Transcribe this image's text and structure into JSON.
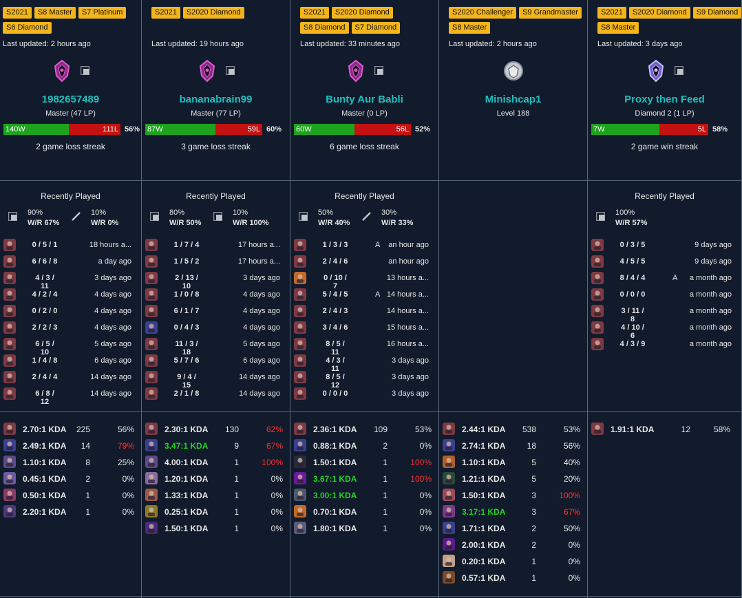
{
  "players": [
    {
      "tags": [
        "S2021",
        "S8 Master",
        "S7 Platinum",
        "S6 Diamond"
      ],
      "last_updated": "Last updated: 2 hours ago",
      "emblem": "master-emblem-icon",
      "name": "1982657489",
      "rank": "Master (47 LP)",
      "wins": "140W",
      "losses": "111L",
      "win_pct": "56%",
      "win_fraction": 0.56,
      "streak": "2 game loss streak",
      "recent_title": "Recently Played",
      "roles": [
        {
          "icon": "jungle-role-icon",
          "pct": "90%",
          "wr": "W/R 67%"
        },
        {
          "icon": "support-role-icon",
          "pct": "10%",
          "wr": "W/R 0%"
        }
      ],
      "recent": [
        {
          "kda": "0 / 5 / 1",
          "role": "",
          "ago": "18 hours a..."
        },
        {
          "kda": "6 / 6 / 8",
          "role": "",
          "ago": "a day ago"
        },
        {
          "kda": "4 / 3 / 11",
          "role": "",
          "ago": "3 days ago"
        },
        {
          "kda": "4 / 2 / 4",
          "role": "",
          "ago": "4 days ago"
        },
        {
          "kda": "0 / 2 / 0",
          "role": "",
          "ago": "4 days ago"
        },
        {
          "kda": "2 / 2 / 3",
          "role": "",
          "ago": "4 days ago"
        },
        {
          "kda": "6 / 5 / 10",
          "role": "",
          "ago": "5 days ago"
        },
        {
          "kda": "1 / 4 / 8",
          "role": "",
          "ago": "6 days ago"
        },
        {
          "kda": "2 / 4 / 4",
          "role": "",
          "ago": "14 days ago"
        },
        {
          "kda": "6 / 8 / 12",
          "role": "",
          "ago": "14 days ago"
        }
      ],
      "recent_champs": [
        "#7d3a44",
        "#7d3a44",
        "#7d3a44",
        "#7d3a44",
        "#7d3a44",
        "#7d3a44",
        "#7d3a44",
        "#7d3a44",
        "#7d3a44",
        "#7d3a44"
      ],
      "stats": [
        {
          "kda": "2.70:1 KDA",
          "games": "225",
          "wr": "56%",
          "kda_color": "",
          "wr_color": "",
          "champ": "#7d3a44"
        },
        {
          "kda": "2.49:1 KDA",
          "games": "14",
          "wr": "79%",
          "kda_color": "",
          "wr_color": "red",
          "champ": "#3b3f8f"
        },
        {
          "kda": "1.10:1 KDA",
          "games": "8",
          "wr": "25%",
          "kda_color": "",
          "wr_color": "",
          "champ": "#5b4a8a"
        },
        {
          "kda": "0.45:1 KDA",
          "games": "2",
          "wr": "0%",
          "kda_color": "",
          "wr_color": "",
          "champ": "#6a5aa0"
        },
        {
          "kda": "0.50:1 KDA",
          "games": "1",
          "wr": "0%",
          "kda_color": "",
          "wr_color": "",
          "champ": "#8a3a6a"
        },
        {
          "kda": "2.20:1 KDA",
          "games": "1",
          "wr": "0%",
          "kda_color": "",
          "wr_color": "",
          "champ": "#4a3a7a"
        }
      ]
    },
    {
      "tags": [
        "S2021",
        "S2020 Diamond"
      ],
      "last_updated": "Last updated: 19 hours ago",
      "emblem": "master-emblem-icon",
      "name": "bananabrain99",
      "rank": "Master (77 LP)",
      "wins": "87W",
      "losses": "59L",
      "win_pct": "60%",
      "win_fraction": 0.6,
      "streak": "3 game loss streak",
      "recent_title": "Recently Played",
      "roles": [
        {
          "icon": "jungle-role-icon",
          "pct": "80%",
          "wr": "W/R 50%"
        },
        {
          "icon": "jungle-role-icon",
          "pct": "10%",
          "wr": "W/R 100%"
        }
      ],
      "recent": [
        {
          "kda": "1 / 7 / 4",
          "role": "",
          "ago": "17 hours a..."
        },
        {
          "kda": "1 / 5 / 2",
          "role": "",
          "ago": "17 hours a..."
        },
        {
          "kda": "2 / 13 / 10",
          "role": "",
          "ago": "3 days ago"
        },
        {
          "kda": "1 / 0 / 8",
          "role": "",
          "ago": "4 days ago"
        },
        {
          "kda": "6 / 1 / 7",
          "role": "",
          "ago": "4 days ago"
        },
        {
          "kda": "0 / 4 / 3",
          "role": "",
          "ago": "4 days ago"
        },
        {
          "kda": "11 / 3 / 18",
          "role": "",
          "ago": "5 days ago"
        },
        {
          "kda": "5 / 7 / 6",
          "role": "",
          "ago": "6 days ago"
        },
        {
          "kda": "9 / 4 / 15",
          "role": "",
          "ago": "14 days ago"
        },
        {
          "kda": "2 / 1 / 8",
          "role": "",
          "ago": "14 days ago"
        }
      ],
      "recent_champs": [
        "#7d3a44",
        "#7d3a44",
        "#7d3a44",
        "#7d3a44",
        "#7d3a44",
        "#3b3f8f",
        "#7d3a44",
        "#7d3a44",
        "#7d3a44",
        "#7d3a44"
      ],
      "stats": [
        {
          "kda": "2.30:1 KDA",
          "games": "130",
          "wr": "62%",
          "kda_color": "",
          "wr_color": "red",
          "champ": "#7d3a44"
        },
        {
          "kda": "3.47:1 KDA",
          "games": "9",
          "wr": "67%",
          "kda_color": "green",
          "wr_color": "red",
          "champ": "#3b3f8f"
        },
        {
          "kda": "4.00:1 KDA",
          "games": "1",
          "wr": "100%",
          "kda_color": "",
          "wr_color": "red",
          "champ": "#5b4a8a"
        },
        {
          "kda": "1.20:1 KDA",
          "games": "1",
          "wr": "0%",
          "kda_color": "",
          "wr_color": "",
          "champ": "#8a6aa0"
        },
        {
          "kda": "1.33:1 KDA",
          "games": "1",
          "wr": "0%",
          "kda_color": "",
          "wr_color": "",
          "champ": "#9a5a4a"
        },
        {
          "kda": "0.25:1 KDA",
          "games": "1",
          "wr": "0%",
          "kda_color": "",
          "wr_color": "",
          "champ": "#8a7a2a"
        },
        {
          "kda": "1.50:1 KDA",
          "games": "1",
          "wr": "0%",
          "kda_color": "",
          "wr_color": "",
          "champ": "#4a2a7a"
        }
      ]
    },
    {
      "tags": [
        "S2021",
        "S2020 Diamond",
        "S8 Diamond",
        "S7 Diamond"
      ],
      "last_updated": "Last updated: 33 minutes ago",
      "emblem": "master-emblem-icon",
      "name": "Bunty Aur Babli",
      "rank": "Master (0 LP)",
      "wins": "60W",
      "losses": "56L",
      "win_pct": "52%",
      "win_fraction": 0.52,
      "streak": "6 game loss streak",
      "recent_title": "Recently Played",
      "roles": [
        {
          "icon": "jungle-role-icon",
          "pct": "50%",
          "wr": "W/R 40%"
        },
        {
          "icon": "support-role-icon",
          "pct": "30%",
          "wr": "W/R 33%"
        }
      ],
      "recent": [
        {
          "kda": "1 / 3 / 3",
          "role": "A",
          "ago": "an hour ago"
        },
        {
          "kda": "2 / 4 / 6",
          "role": "",
          "ago": "an hour ago"
        },
        {
          "kda": "0 / 10 / 7",
          "role": "",
          "ago": "13 hours a..."
        },
        {
          "kda": "5 / 4 / 5",
          "role": "A",
          "ago": "14 hours a..."
        },
        {
          "kda": "2 / 4 / 3",
          "role": "",
          "ago": "14 hours a..."
        },
        {
          "kda": "3 / 4 / 6",
          "role": "",
          "ago": "15 hours a..."
        },
        {
          "kda": "8 / 5 / 11",
          "role": "",
          "ago": "16 hours a..."
        },
        {
          "kda": "4 / 3 / 11",
          "role": "",
          "ago": "3 days ago"
        },
        {
          "kda": "8 / 5 / 12",
          "role": "",
          "ago": "3 days ago"
        },
        {
          "kda": "0 / 0 / 0",
          "role": "",
          "ago": "3 days ago"
        }
      ],
      "recent_champs": [
        "#7d3a44",
        "#7d3a44",
        "#c06a2a",
        "#7d3a44",
        "#7d3a44",
        "#7d3a44",
        "#7d3a44",
        "#7d3a44",
        "#7d3a44",
        "#7d3a44"
      ],
      "stats": [
        {
          "kda": "2.36:1 KDA",
          "games": "109",
          "wr": "53%",
          "kda_color": "",
          "wr_color": "",
          "champ": "#7d3a44"
        },
        {
          "kda": "0.88:1 KDA",
          "games": "2",
          "wr": "0%",
          "kda_color": "",
          "wr_color": "",
          "champ": "#3b3f8f"
        },
        {
          "kda": "1.50:1 KDA",
          "games": "1",
          "wr": "100%",
          "kda_color": "",
          "wr_color": "red",
          "champ": "#2a2a3a"
        },
        {
          "kda": "3.67:1 KDA",
          "games": "1",
          "wr": "100%",
          "kda_color": "green",
          "wr_color": "red",
          "champ": "#6a1a9a"
        },
        {
          "kda": "3.00:1 KDA",
          "games": "1",
          "wr": "0%",
          "kda_color": "green",
          "wr_color": "",
          "champ": "#4a5a6a"
        },
        {
          "kda": "0.70:1 KDA",
          "games": "1",
          "wr": "0%",
          "kda_color": "",
          "wr_color": "",
          "champ": "#c06a2a"
        },
        {
          "kda": "1.80:1 KDA",
          "games": "1",
          "wr": "0%",
          "kda_color": "",
          "wr_color": "",
          "champ": "#5a5a7a"
        }
      ]
    },
    {
      "tags": [
        "S2020 Challenger",
        "S9 Grandmaster",
        "S8 Master"
      ],
      "last_updated": "Last updated: 2 hours ago",
      "emblem": "unranked-emblem-icon",
      "name": "Minishcap1",
      "rank": "Level 188",
      "wins": "",
      "losses": "",
      "win_pct": "",
      "win_fraction": 0,
      "streak": "",
      "recent_title": "",
      "roles": [],
      "recent": [],
      "recent_champs": [],
      "stats": [
        {
          "kda": "2.44:1 KDA",
          "games": "538",
          "wr": "53%",
          "kda_color": "",
          "wr_color": "",
          "champ": "#7d3a44"
        },
        {
          "kda": "2.74:1 KDA",
          "games": "18",
          "wr": "56%",
          "kda_color": "",
          "wr_color": "",
          "champ": "#3b3f8f"
        },
        {
          "kda": "1.10:1 KDA",
          "games": "5",
          "wr": "40%",
          "kda_color": "",
          "wr_color": "",
          "champ": "#b0602a"
        },
        {
          "kda": "1.21:1 KDA",
          "games": "5",
          "wr": "20%",
          "kda_color": "",
          "wr_color": "",
          "champ": "#2a4a3a"
        },
        {
          "kda": "1.50:1 KDA",
          "games": "3",
          "wr": "100%",
          "kda_color": "",
          "wr_color": "red",
          "champ": "#9a4a5a"
        },
        {
          "kda": "3.17:1 KDA",
          "games": "3",
          "wr": "67%",
          "kda_color": "green",
          "wr_color": "red",
          "champ": "#7a3a8a"
        },
        {
          "kda": "1.71:1 KDA",
          "games": "2",
          "wr": "50%",
          "kda_color": "",
          "wr_color": "",
          "champ": "#3b3f8f"
        },
        {
          "kda": "2.00:1 KDA",
          "games": "2",
          "wr": "0%",
          "kda_color": "",
          "wr_color": "",
          "champ": "#5a1a8a"
        },
        {
          "kda": "0.20:1 KDA",
          "games": "1",
          "wr": "0%",
          "kda_color": "",
          "wr_color": "",
          "champ": "#c0a08a"
        },
        {
          "kda": "0.57:1 KDA",
          "games": "1",
          "wr": "0%",
          "kda_color": "",
          "wr_color": "",
          "champ": "#7a4a2a"
        }
      ]
    },
    {
      "tags": [
        "S2021",
        "S2020 Diamond",
        "S9 Diamond",
        "S8 Master"
      ],
      "last_updated": "Last updated: 3 days ago",
      "emblem": "diamond-emblem-icon",
      "name": "Proxy then Feed",
      "rank": "Diamond 2 (1 LP)",
      "wins": "7W",
      "losses": "5L",
      "win_pct": "58%",
      "win_fraction": 0.58,
      "streak": "2 game win streak",
      "recent_title": "Recently Played",
      "roles": [
        {
          "icon": "jungle-role-icon",
          "pct": "100%",
          "wr": "W/R 57%"
        }
      ],
      "recent": [
        {
          "kda": "0 / 3 / 5",
          "role": "",
          "ago": "9 days ago"
        },
        {
          "kda": "4 / 5 / 5",
          "role": "",
          "ago": "9 days ago"
        },
        {
          "kda": "8 / 4 / 4",
          "role": "A",
          "ago": "a month ago"
        },
        {
          "kda": "0 / 0 / 0",
          "role": "",
          "ago": "a month ago"
        },
        {
          "kda": "3 / 11 / 8",
          "role": "",
          "ago": "a month ago"
        },
        {
          "kda": "4 / 10 / 6",
          "role": "",
          "ago": "a month ago"
        },
        {
          "kda": "4 / 3 / 9",
          "role": "",
          "ago": "a month ago"
        }
      ],
      "recent_champs": [
        "#7d3a44",
        "#7d3a44",
        "#7d3a44",
        "#7d3a44",
        "#7d3a44",
        "#7d3a44",
        "#7d3a44"
      ],
      "stats": [
        {
          "kda": "1.91:1 KDA",
          "games": "12",
          "wr": "58%",
          "kda_color": "",
          "wr_color": "",
          "champ": "#7d3a44"
        }
      ]
    }
  ]
}
